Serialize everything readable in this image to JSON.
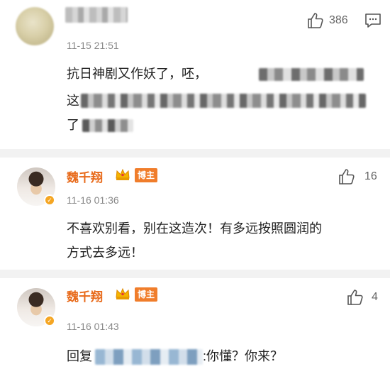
{
  "comments": [
    {
      "time": "11-15 21:51",
      "likes": "386",
      "text_line1": "抗日神剧又作妖了，呸，",
      "text_line2": "这",
      "text_line3": "了"
    },
    {
      "name": "魏千翔",
      "tag": "博主",
      "time": "11-16 01:36",
      "likes": "16",
      "text_line1": "不喜欢别看，别在这造次！有多远按照圆润的",
      "text_line2": "方式去多远！"
    },
    {
      "name": "魏千翔",
      "tag": "博主",
      "time": "11-16 01:43",
      "likes": "4",
      "reply_prefix": "回复",
      "reply_suffix": ":你懂？你来？"
    }
  ],
  "icons": {
    "like": "thumbs-up-icon",
    "message": "message-icon",
    "crown": "crown-icon",
    "verified": "verified-badge-icon"
  },
  "colors": {
    "name": "#e86a1a",
    "tag_bg": "#f07d2b",
    "separator": "#f2f2f2"
  }
}
